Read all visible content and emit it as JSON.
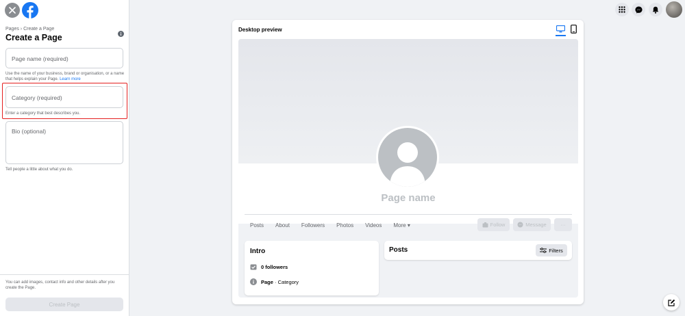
{
  "sidebar": {
    "breadcrumb": "Pages › Create a Page",
    "title": "Create a Page",
    "fields": {
      "page_name": {
        "placeholder": "Page name (required)",
        "help": "Use the name of your business, brand or organisation, or a name that helps explain your Page.",
        "help_link": "Learn more"
      },
      "category": {
        "placeholder": "Category (required)",
        "help": "Enter a category that best describes you."
      },
      "bio": {
        "placeholder": "Bio (optional)",
        "help": "Tell people a little about what you do."
      }
    },
    "footer_note": "You can add images, contact info and other details after you create the Page.",
    "create_button": "Create Page"
  },
  "preview": {
    "title": "Desktop preview",
    "page_name": "Page name",
    "tabs": [
      "Posts",
      "About",
      "Followers",
      "Photos",
      "Videos"
    ],
    "more_tab": "More ▾",
    "buttons": {
      "follow": "Follow",
      "message": "Message",
      "more": "···"
    },
    "intro": {
      "title": "Intro",
      "followers": "0 followers",
      "page_label": "Page",
      "category_text": " · Category"
    },
    "posts": {
      "title": "Posts",
      "filters": "Filters"
    }
  },
  "colors": {
    "accent": "#1877f2",
    "highlight": "#e41e1e",
    "disabled": "#bcc0c4"
  }
}
